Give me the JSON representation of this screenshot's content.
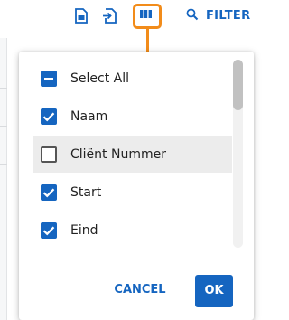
{
  "toolbar": {
    "icons": [
      "document-export-icon",
      "document-import-icon",
      "columns-icon",
      "search-icon"
    ],
    "filter_label": "FILTER",
    "accent_color": "#1565c0",
    "highlight_color": "#f28c1a"
  },
  "columns_menu": {
    "options": [
      {
        "label": "Select All",
        "state": "indeterminate"
      },
      {
        "label": "Naam",
        "state": "checked"
      },
      {
        "label": "Cliënt Nummer",
        "state": "unchecked"
      },
      {
        "label": "Start",
        "state": "checked"
      },
      {
        "label": "Eind",
        "state": "checked"
      }
    ],
    "cancel_label": "CANCEL",
    "ok_label": "OK"
  }
}
